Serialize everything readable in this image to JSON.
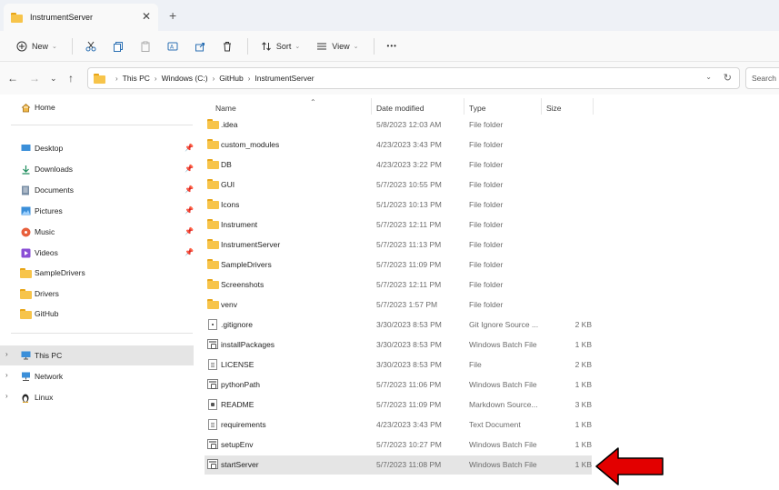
{
  "window": {
    "tab_title": "InstrumentServer",
    "close_glyph": "✕",
    "new_tab_glyph": "+"
  },
  "toolbar": {
    "new_label": "New",
    "sort_label": "Sort",
    "view_label": "View",
    "more_glyph": "•••"
  },
  "address": {
    "breadcrumbs": [
      "This PC",
      "Windows (C:)",
      "GitHub",
      "InstrumentServer"
    ],
    "search_placeholder": "Search InstrumentServer"
  },
  "sidebar": {
    "home": "Home",
    "quick_access": [
      {
        "label": "Desktop",
        "icon": "desktop-icon",
        "pinned": true
      },
      {
        "label": "Downloads",
        "icon": "downloads-icon",
        "pinned": true
      },
      {
        "label": "Documents",
        "icon": "documents-icon",
        "pinned": true
      },
      {
        "label": "Pictures",
        "icon": "pictures-icon",
        "pinned": true
      },
      {
        "label": "Music",
        "icon": "music-icon",
        "pinned": true
      },
      {
        "label": "Videos",
        "icon": "videos-icon",
        "pinned": true
      },
      {
        "label": "SampleDrivers",
        "icon": "folder-icon",
        "pinned": false
      },
      {
        "label": "Drivers",
        "icon": "folder-icon",
        "pinned": false
      },
      {
        "label": "GitHub",
        "icon": "folder-icon",
        "pinned": false
      }
    ],
    "locations": [
      {
        "label": "This PC",
        "icon": "pc-icon",
        "selected": true
      },
      {
        "label": "Network",
        "icon": "network-icon",
        "selected": false
      },
      {
        "label": "Linux",
        "icon": "linux-icon",
        "selected": false
      }
    ]
  },
  "columns": {
    "name": "Name",
    "date": "Date modified",
    "type": "Type",
    "size": "Size"
  },
  "files": [
    {
      "name": ".idea",
      "date": "5/8/2023 12:03 AM",
      "type": "File folder",
      "size": "",
      "kind": "folder"
    },
    {
      "name": "custom_modules",
      "date": "4/23/2023 3:43 PM",
      "type": "File folder",
      "size": "",
      "kind": "folder"
    },
    {
      "name": "DB",
      "date": "4/23/2023 3:22 PM",
      "type": "File folder",
      "size": "",
      "kind": "folder"
    },
    {
      "name": "GUI",
      "date": "5/7/2023 10:55 PM",
      "type": "File folder",
      "size": "",
      "kind": "folder"
    },
    {
      "name": "Icons",
      "date": "5/1/2023 10:13 PM",
      "type": "File folder",
      "size": "",
      "kind": "folder"
    },
    {
      "name": "Instrument",
      "date": "5/7/2023 12:11 PM",
      "type": "File folder",
      "size": "",
      "kind": "folder"
    },
    {
      "name": "InstrumentServer",
      "date": "5/7/2023 11:13 PM",
      "type": "File folder",
      "size": "",
      "kind": "folder"
    },
    {
      "name": "SampleDrivers",
      "date": "5/7/2023 11:09 PM",
      "type": "File folder",
      "size": "",
      "kind": "folder"
    },
    {
      "name": "Screenshots",
      "date": "5/7/2023 12:11 PM",
      "type": "File folder",
      "size": "",
      "kind": "folder"
    },
    {
      "name": "venv",
      "date": "5/7/2023 1:57 PM",
      "type": "File folder",
      "size": "",
      "kind": "folder"
    },
    {
      "name": ".gitignore",
      "date": "3/30/2023 8:53 PM",
      "type": "Git Ignore Source ...",
      "size": "2 KB",
      "kind": "git"
    },
    {
      "name": "installPackages",
      "date": "3/30/2023 8:53 PM",
      "type": "Windows Batch File",
      "size": "1 KB",
      "kind": "bat"
    },
    {
      "name": "LICENSE",
      "date": "3/30/2023 8:53 PM",
      "type": "File",
      "size": "2 KB",
      "kind": "file"
    },
    {
      "name": "pythonPath",
      "date": "5/7/2023 11:06 PM",
      "type": "Windows Batch File",
      "size": "1 KB",
      "kind": "bat"
    },
    {
      "name": "README",
      "date": "5/7/2023 11:09 PM",
      "type": "Markdown Source...",
      "size": "3 KB",
      "kind": "md"
    },
    {
      "name": "requirements",
      "date": "4/23/2023 3:43 PM",
      "type": "Text Document",
      "size": "1 KB",
      "kind": "file"
    },
    {
      "name": "setupEnv",
      "date": "5/7/2023 10:27 PM",
      "type": "Windows Batch File",
      "size": "1 KB",
      "kind": "bat"
    },
    {
      "name": "startServer",
      "date": "5/7/2023 11:08 PM",
      "type": "Windows Batch File",
      "size": "1 KB",
      "kind": "bat",
      "selected": true
    }
  ],
  "colors": {
    "accent_red": "#e30000",
    "folder_yellow": "#f7c44a",
    "selection_gray": "#e5e5e5"
  }
}
